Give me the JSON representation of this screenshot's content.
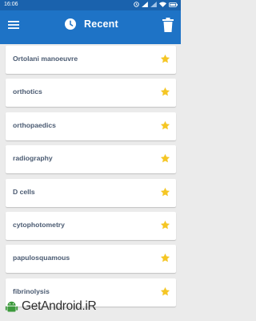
{
  "status_bar": {
    "time": "16:06",
    "battery_icon": "battery-icon",
    "wifi_icon": "wifi-icon",
    "signal_icon": "signal-icon"
  },
  "app_bar": {
    "title": "Recent",
    "menu_icon": "hamburger-menu-icon",
    "title_icon": "clock-icon",
    "action_icon": "trash-icon",
    "background": "#1e73c6",
    "status_background": "#1a62ad"
  },
  "recent_items": [
    {
      "label": "Ortolani manoeuvre",
      "starred": true
    },
    {
      "label": "orthotics",
      "starred": true
    },
    {
      "label": "orthopaedics",
      "starred": true
    },
    {
      "label": "radiography",
      "starred": true
    },
    {
      "label": "D cells",
      "starred": true
    },
    {
      "label": "cytophotometry",
      "starred": true
    },
    {
      "label": "papulosquamous",
      "starred": true
    },
    {
      "label": "fibrinolysis",
      "starred": true
    }
  ],
  "colors": {
    "star": "#f5c624",
    "label_text": "#4b5b72",
    "page_background": "#ebebeb"
  },
  "watermark": {
    "text": "GetAndroid.iR"
  }
}
